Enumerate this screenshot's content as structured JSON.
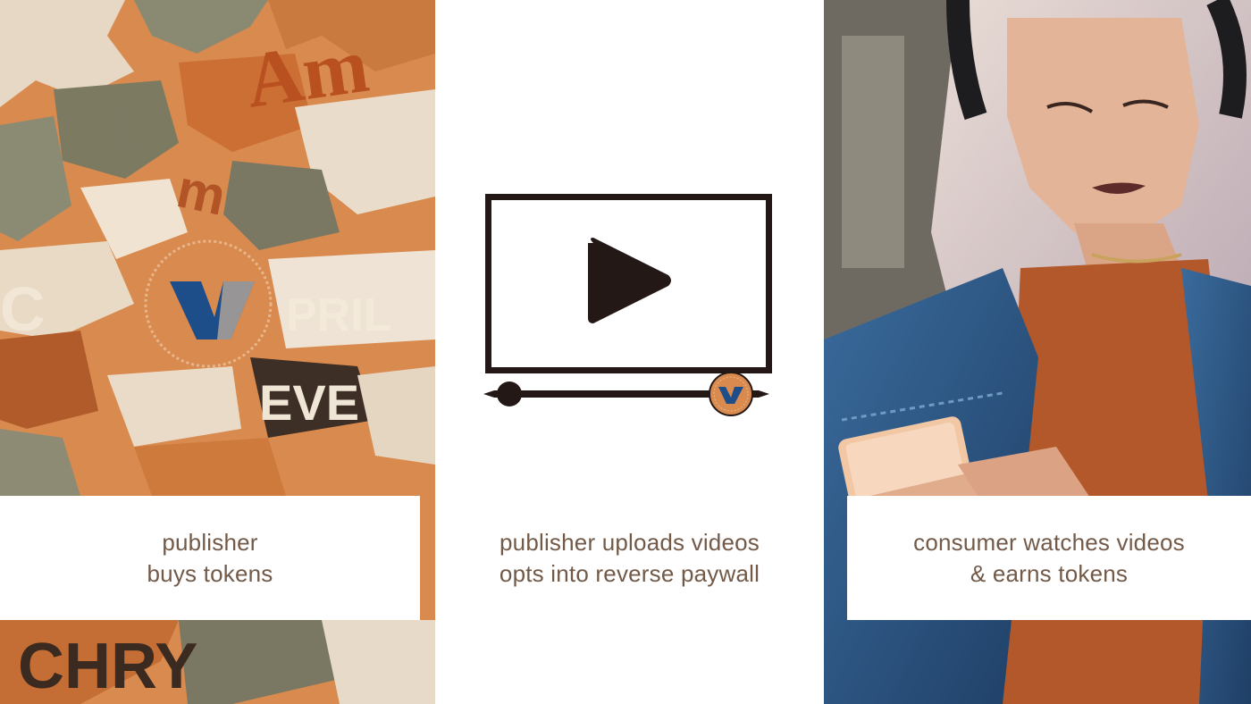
{
  "steps": [
    {
      "line1": "publisher",
      "line2": "buys tokens",
      "image": "torn-poster-collage-with-v-coin"
    },
    {
      "line1": "publisher uploads videos",
      "line2": "opts into reverse paywall",
      "image": "video-player-play-icon"
    },
    {
      "line1": "consumer watches videos",
      "line2": "& earns tokens",
      "image": "woman-with-headphones-watching-phone"
    }
  ],
  "colors": {
    "caption_text": "#735a48",
    "icon_dark": "#231815",
    "token_orange": "#d98a4e",
    "token_blue": "#1d4e89",
    "background": "#ffffff"
  },
  "icons": [
    "v-token-icon",
    "play-icon",
    "progress-knob-icon"
  ]
}
